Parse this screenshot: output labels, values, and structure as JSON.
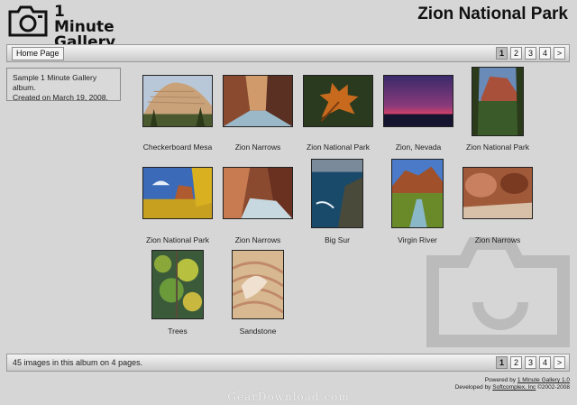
{
  "logo": {
    "line1": "1 Minute",
    "line2": "Gallery"
  },
  "page_title": "Zion National Park",
  "nav": {
    "home_label": "Home Page",
    "pages": [
      "1",
      "2",
      "3",
      "4",
      ">"
    ],
    "active_page": "1"
  },
  "description": {
    "line1": "Sample 1 Minute Gallery album.",
    "line2": "Created on March 19, 2008."
  },
  "thumbnails": [
    {
      "caption": "Checkerboard Mesa",
      "icon": "photo"
    },
    {
      "caption": "Zion Narrows",
      "icon": "photo"
    },
    {
      "caption": "Zion National Park",
      "icon": "photo"
    },
    {
      "caption": "Zion, Nevada",
      "icon": "photo"
    },
    {
      "caption": "Zion National Park",
      "icon": "photo"
    },
    {
      "caption": "Zion National Park",
      "icon": "photo"
    },
    {
      "caption": "Zion Narrows",
      "icon": "photo"
    },
    {
      "caption": "Big Sur",
      "icon": "photo"
    },
    {
      "caption": "Virgin River",
      "icon": "photo"
    },
    {
      "caption": "Zion Narrows",
      "icon": "photo"
    },
    {
      "caption": "Trees",
      "icon": "photo"
    },
    {
      "caption": "Sandstone",
      "icon": "photo"
    }
  ],
  "bottom_bar": {
    "count_text": "45 images in this album on 4 pages."
  },
  "footer": {
    "powered_prefix": "Powered by ",
    "powered_link": "1 Minute Gallery 1.0",
    "dev_prefix": "Developed by ",
    "dev_link": "Softcomplex, Inc",
    "dev_suffix": " ©2002-2008"
  },
  "watermark_text": "GearDownload.com",
  "colors": {
    "background": "#d6d6d6",
    "bar_top": "#f4f4f4",
    "bar_bottom": "#c9c9c9",
    "border": "#8c8c8c"
  }
}
